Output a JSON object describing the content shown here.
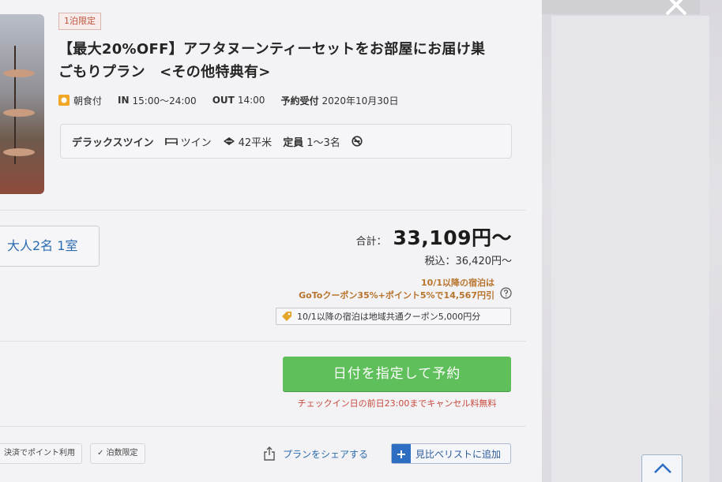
{
  "plan": {
    "badge": "1泊限定",
    "title_line1": "【最大20%OFF】アフタヌーンティーセットをお部屋にお届け巣",
    "title_line2": "ごもりプラン　<その他特典有>",
    "meal": "朝食付",
    "checkin_label": "IN",
    "checkin_value": "15:00～24:00",
    "checkout_label": "OUT",
    "checkout_value": "14:00",
    "reservation_label": "予約受付",
    "reservation_value": "2020年10月30日"
  },
  "room": {
    "name": "デラックスツイン",
    "bed": "ツイン",
    "size": "42平米",
    "capacity_label": "定員",
    "capacity_value": "1～3名",
    "icons": [
      "bed-icon",
      "area-icon",
      "no-smoking-icon"
    ]
  },
  "guests": {
    "selection": "大人2名 1室"
  },
  "price": {
    "total_label": "合計：",
    "total_value": "33,109円～",
    "tax_included": "税込：36,420円～",
    "goto_line1": "10/1以降の宿泊は",
    "goto_line2": "GoToクーポン35%+ポイント5%で14,567円引",
    "coupon_text": "10/1以降の宿泊は地域共通クーポン5,000円分"
  },
  "actions": {
    "reserve_label": "日付を指定して予約",
    "cancel_note": "チェックイン日の前日23:00までキャンセル料無料",
    "share_label": "プランをシェアする",
    "compare_label": "見比べリストに追加"
  },
  "features": {
    "point_payment": "決済でポイント利用",
    "nights_limited": "✓ 泊数限定"
  },
  "colors": {
    "accent_green": "#5fbf5a",
    "link_blue": "#2b6cb0",
    "notice_red": "#c94a3e",
    "goto_orange": "#b8742c"
  }
}
